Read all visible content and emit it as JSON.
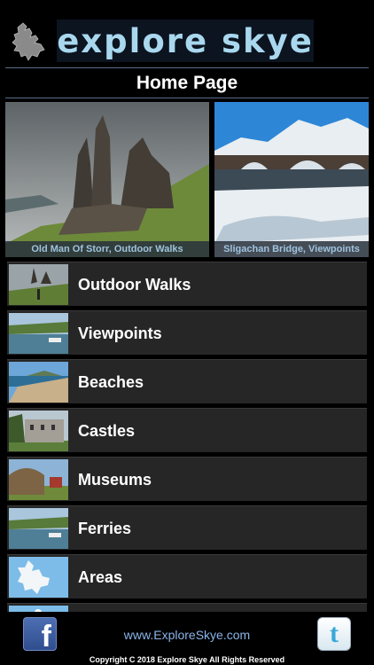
{
  "header": {
    "brand": "explore skye",
    "page_title": "Home Page"
  },
  "featured": [
    {
      "caption": "Old Man Of Storr, Outdoor Walks"
    },
    {
      "caption": "Sligachan Bridge, Viewpoints"
    }
  ],
  "categories": [
    {
      "label": "Outdoor Walks"
    },
    {
      "label": "Viewpoints"
    },
    {
      "label": "Beaches"
    },
    {
      "label": "Castles"
    },
    {
      "label": "Museums"
    },
    {
      "label": "Ferries"
    },
    {
      "label": "Areas"
    }
  ],
  "footer": {
    "website": "www.ExploreSkye.com",
    "copyright": "Copyright C 2018 Explore Skye All Rights Reserved"
  },
  "icons": {
    "logo": "skye-island-logo-icon",
    "facebook": "facebook-icon",
    "twitter": "twitter-icon",
    "magnifier": "magnifier-icon"
  },
  "colors": {
    "brand": "#a9d8ee",
    "link": "#8ab4e8",
    "row_bg": "#262626"
  }
}
